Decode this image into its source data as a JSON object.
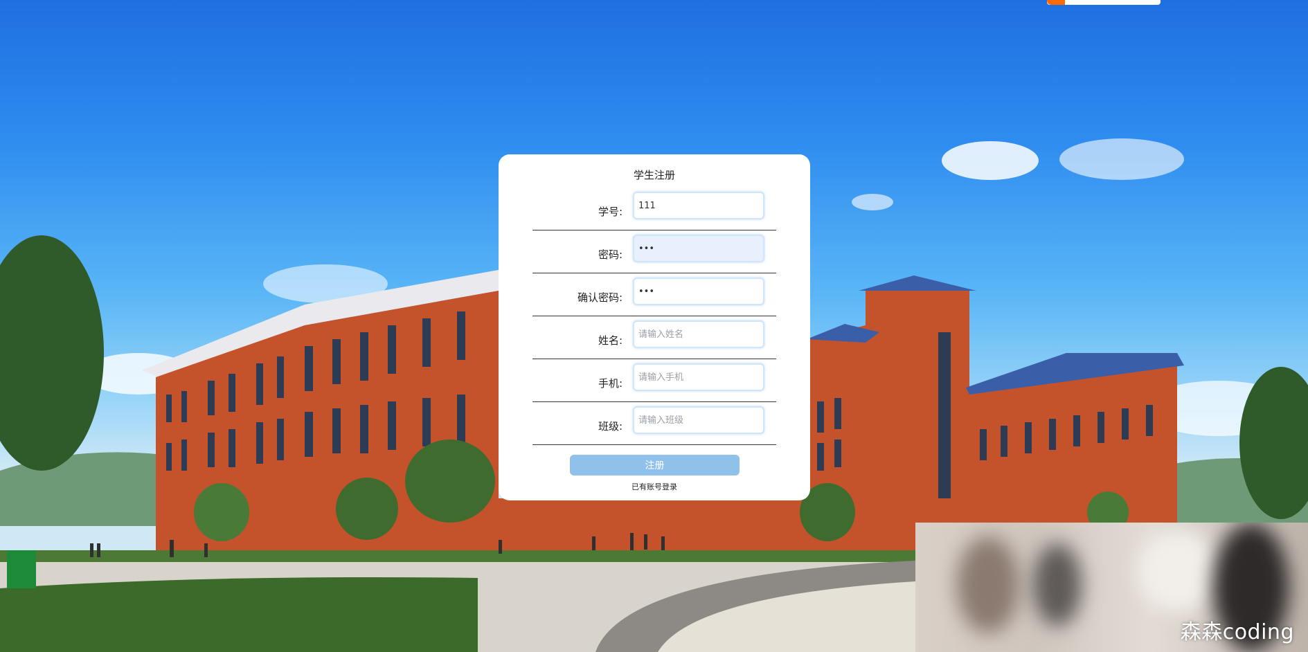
{
  "form": {
    "title": "学生注册",
    "fields": [
      {
        "label": "学号:",
        "value": "111",
        "placeholder": "",
        "type": "text"
      },
      {
        "label": "密码:",
        "value": "•••",
        "placeholder": "",
        "type": "password"
      },
      {
        "label": "确认密码:",
        "value": "•••",
        "placeholder": "",
        "type": "password"
      },
      {
        "label": "姓名:",
        "value": "",
        "placeholder": "请输入姓名",
        "type": "text"
      },
      {
        "label": "手机:",
        "value": "",
        "placeholder": "请输入手机",
        "type": "text"
      },
      {
        "label": "班级:",
        "value": "",
        "placeholder": "请输入班级",
        "type": "text"
      }
    ],
    "submit_label": "注册",
    "login_link": "已有账号登录"
  },
  "webcam": {
    "watermark": "森森coding"
  },
  "colors": {
    "button": "#8fc1ea",
    "sky_top": "#1f6fe0",
    "building": "#c8552e"
  }
}
